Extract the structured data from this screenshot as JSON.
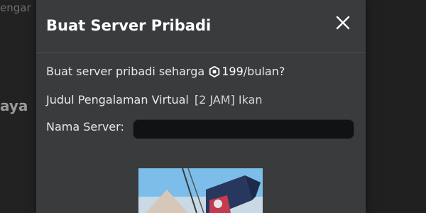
{
  "background": {
    "top_text": "engar",
    "side_text": "aya"
  },
  "modal": {
    "title": "Buat Server Pribadi",
    "close_icon": "close-icon",
    "price_prefix": "Buat server pribadi seharga",
    "currency_icon": "robux-icon",
    "price_value": "199",
    "price_suffix": "/bulan?",
    "experience_label": "Judul Pengalaman Virtual",
    "experience_name": "[2 JAM] Ikan",
    "server_name_label": "Nama Server:",
    "server_name_value": "",
    "server_name_placeholder": ""
  },
  "colors": {
    "modal_bg": "#393b3d",
    "input_bg": "#111213",
    "text": "#e8e8e8"
  }
}
